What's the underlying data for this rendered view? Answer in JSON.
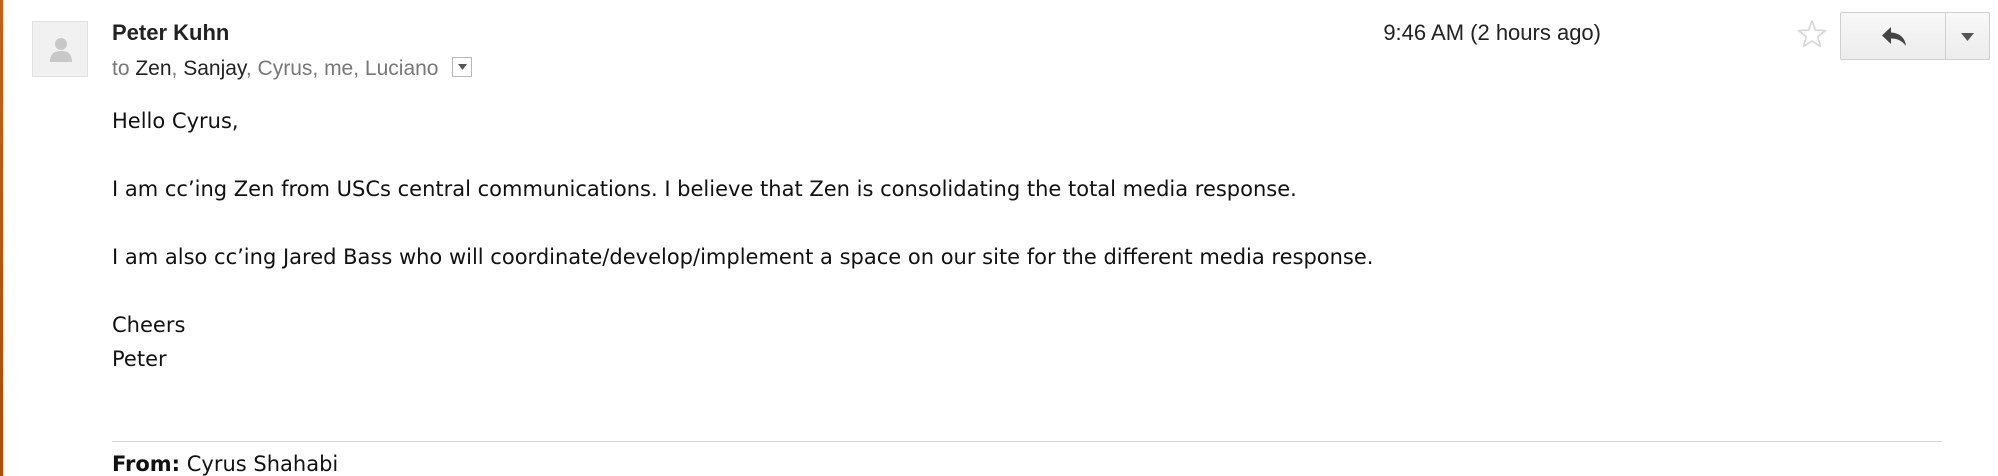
{
  "message": {
    "sender_name": "Peter Kuhn",
    "to_prefix": "to",
    "recipients": [
      {
        "name": "Zen",
        "sep": ", "
      },
      {
        "name": "Sanjay",
        "sep": ", "
      },
      {
        "name": "Cyrus",
        "sep": ", "
      },
      {
        "name": "me",
        "sep": ", "
      },
      {
        "name": "Luciano",
        "sep": ""
      }
    ],
    "time": "9:46 AM (2 hours ago)",
    "body": {
      "greeting": "Hello Cyrus,",
      "para1": "I am cc’ing Zen from USCs central communications. I believe that Zen is consolidating the total media response.",
      "para2": "I am also cc’ing Jared Bass who will coordinate/develop/implement a space on our site for the different media response.",
      "closing": "Cheers",
      "signature": "Peter"
    },
    "quoted": {
      "from_label": "From:",
      "from_value": "Cyrus Shahabi"
    }
  },
  "icons": {
    "avatar": "default-avatar-icon",
    "recipients_dropdown": "chevron-down-icon",
    "star": "star-icon",
    "reply": "reply-icon",
    "more": "chevron-down-icon"
  },
  "colors": {
    "muted_text": "#777777",
    "edge_accent": "#c0621e"
  }
}
